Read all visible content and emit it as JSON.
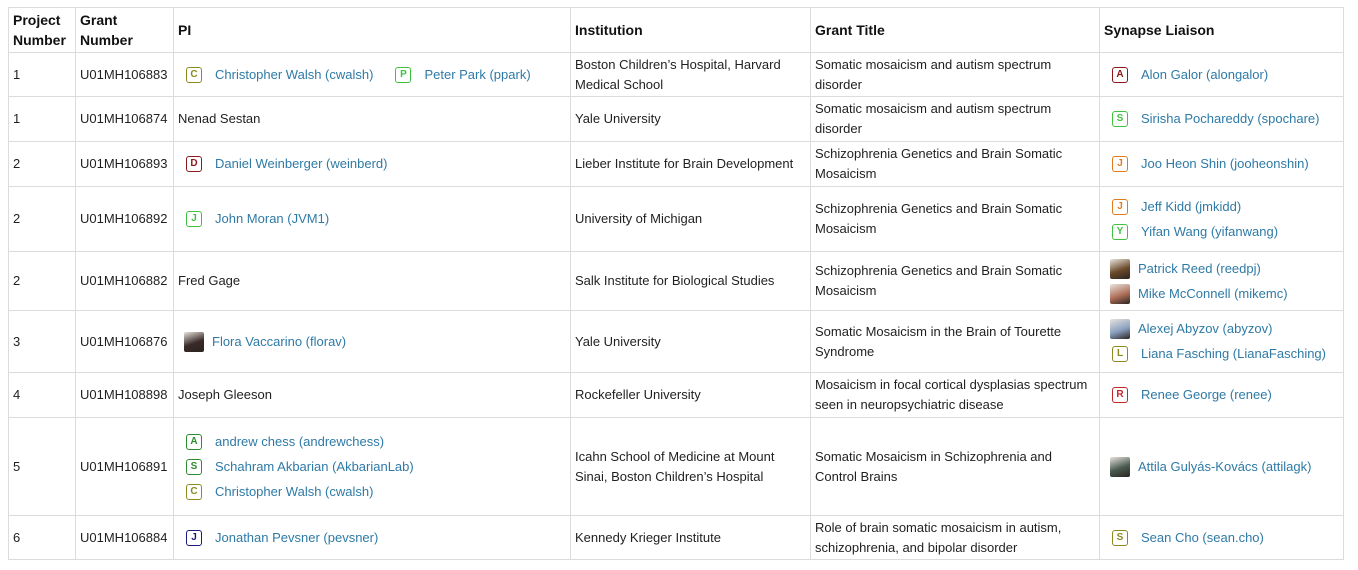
{
  "columns": [
    "Project Number",
    "Grant Number",
    "PI",
    "Institution",
    "Grant Title",
    "Synapse Liaison"
  ],
  "rows": [
    {
      "project": "1",
      "grant": "U01MH106883",
      "pi_text": "",
      "pi_users": [
        {
          "name": "Christopher Walsh (cwalsh)",
          "badge": "C",
          "color": "#8a8a1e"
        },
        {
          "name": "Peter Park (ppark)",
          "badge": "P",
          "color": "#3fc23f"
        }
      ],
      "institution": "Boston Children’s Hospital, Harvard Medical School",
      "title": "Somatic mosaicism and autism spectrum disorder",
      "liaisons": [
        {
          "name": "Alon Galor (alongalor)",
          "badge": "A",
          "color": "#8b1a1a"
        }
      ]
    },
    {
      "project": "1",
      "grant": "U01MH106874",
      "pi_text": "Nenad Sestan",
      "pi_users": [],
      "institution": "Yale University",
      "title": "Somatic mosaicism and autism spectrum disorder",
      "liaisons": [
        {
          "name": "Sirisha Pochareddy (spochare)",
          "badge": "S",
          "color": "#3fc23f"
        }
      ]
    },
    {
      "project": "2",
      "grant": "U01MH106893",
      "pi_text": "",
      "pi_users": [
        {
          "name": "Daniel Weinberger (weinberd)",
          "badge": "D",
          "color": "#8b1a1a"
        }
      ],
      "institution": "Lieber Institute for Brain Development",
      "title": "Schizophrenia Genetics and Brain Somatic Mosaicism",
      "liaisons": [
        {
          "name": "Joo Heon Shin (jooheonshin)",
          "badge": "J",
          "color": "#e07a1f"
        }
      ]
    },
    {
      "project": "2",
      "grant": "U01MH106892",
      "pi_text": "",
      "pi_users": [
        {
          "name": "John Moran (JVM1)",
          "badge": "J",
          "color": "#3fc23f"
        }
      ],
      "institution": "University of Michigan",
      "title": "Schizophrenia Genetics and Brain Somatic Mosaicism",
      "liaisons": [
        {
          "name": "Jeff Kidd (jmkidd)",
          "badge": "J",
          "color": "#e07a1f"
        },
        {
          "name": "Yifan Wang (yifanwang)",
          "badge": "Y",
          "color": "#3fc23f"
        }
      ]
    },
    {
      "project": "2",
      "grant": "U01MH106882",
      "pi_text": "Fred Gage",
      "pi_users": [],
      "institution": "Salk Institute for Biological Studies",
      "title": "Schizophrenia Genetics and Brain Somatic Mosaicism",
      "liaisons": [
        {
          "name": "Patrick Reed (reedpj)",
          "avatar": true,
          "color": "#6b4a2a"
        },
        {
          "name": "Mike McConnell (mikemc)",
          "avatar": true,
          "color": "#b0705a"
        }
      ]
    },
    {
      "project": "3",
      "grant": "U01MH106876",
      "pi_text": "",
      "pi_users": [
        {
          "name": "Flora Vaccarino (florav)",
          "avatar": true,
          "color": "#3a2a28"
        }
      ],
      "institution": "Yale University",
      "title": "Somatic Mosaicism in the Brain of Tourette Syndrome",
      "liaisons": [
        {
          "name": "Alexej Abyzov (abyzov)",
          "avatar": true,
          "color": "#8aa0c0"
        },
        {
          "name": "Liana Fasching (LianaFasching)",
          "badge": "L",
          "color": "#8a8a1e"
        }
      ]
    },
    {
      "project": "4",
      "grant": "U01MH108898",
      "pi_text": "Joseph Gleeson",
      "pi_users": [],
      "institution": "Rockefeller University",
      "title": "Mosaicism in focal cortical dysplasias spectrum seen in neuropsychiatric disease",
      "liaisons": [
        {
          "name": "Renee George (renee)",
          "badge": "R",
          "color": "#c0282a"
        }
      ]
    },
    {
      "project": "5",
      "grant": "U01MH106891",
      "pi_text": "",
      "pi_users": [
        {
          "name": "andrew chess (andrewchess)",
          "badge": "A",
          "color": "#2e8b2e"
        },
        {
          "name": "Schahram Akbarian (AkbarianLab)",
          "badge": "S",
          "color": "#2e8b2e"
        },
        {
          "name": "Christopher Walsh (cwalsh)",
          "badge": "C",
          "color": "#8a8a1e"
        }
      ],
      "institution": "Icahn School of Medicine at Mount Sinai, Boston Children’s Hospital",
      "title": "Somatic Mosaicism in Schizophrenia and Control Brains",
      "liaisons": [
        {
          "name": "Attila Gulyás-Kovács (attilagk)",
          "avatar": true,
          "color": "#4a5a50"
        }
      ]
    },
    {
      "project": "6",
      "grant": "U01MH106884",
      "pi_text": "",
      "pi_users": [
        {
          "name": "Jonathan Pevsner (pevsner)",
          "badge": "J",
          "color": "#1a1a7a"
        }
      ],
      "institution": "Kennedy Krieger Institute",
      "title": "Role of brain somatic mosaicism in autism, schizophrenia, and bipolar disorder",
      "liaisons": [
        {
          "name": "Sean Cho (sean.cho)",
          "badge": "S",
          "color": "#8a8a1e"
        }
      ]
    }
  ]
}
